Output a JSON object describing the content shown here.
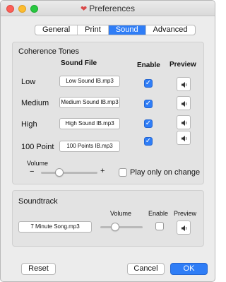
{
  "window": {
    "title": "Preferences",
    "app_icon": "heart-icon"
  },
  "tabs": [
    {
      "label": "General",
      "active": false
    },
    {
      "label": "Print",
      "active": false
    },
    {
      "label": "Sound",
      "active": true
    },
    {
      "label": "Advanced",
      "active": false
    }
  ],
  "coherence": {
    "title": "Coherence Tones",
    "col_sound_file": "Sound File",
    "col_enable": "Enable",
    "col_preview": "Preview",
    "rows": [
      {
        "label": "Low",
        "file": "Low Sound IB.mp3",
        "enabled": true
      },
      {
        "label": "Medium",
        "file": "Medium Sound IB.mp3",
        "enabled": true
      },
      {
        "label": "High",
        "file": "High Sound IB.mp3",
        "enabled": true
      },
      {
        "label": "100 Point",
        "file": "100 Points IB.mp3",
        "enabled": true
      }
    ],
    "volume_label": "Volume",
    "volume_minus": "−",
    "volume_plus": "+",
    "volume_level": 0.33,
    "play_only_on_change_label": "Play only on change",
    "play_only_on_change": false
  },
  "soundtrack": {
    "title": "Soundtrack",
    "file": "7 Minute Song.mp3",
    "volume_label": "Volume",
    "volume_level": 0.35,
    "enable_label": "Enable",
    "enabled": false,
    "preview_label": "Preview"
  },
  "footer": {
    "reset_label": "Reset",
    "cancel_label": "Cancel",
    "ok_label": "OK"
  },
  "colors": {
    "accent": "#2f7df6"
  }
}
